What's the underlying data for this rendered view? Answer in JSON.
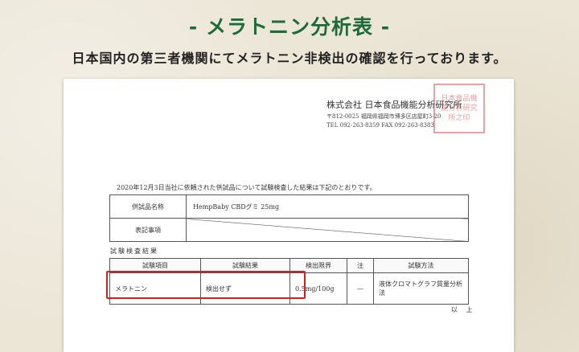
{
  "title": "- メラトニン分析表 -",
  "subtitle": "日本国内の第三者機関にてメラトニン非検出の確認を行っております。",
  "document": {
    "lab_name": "株式会社 日本食品機能分析研究所",
    "lab_postal_address": "〒812-0025 福岡県福岡市博多区店屋町3-20",
    "lab_phone_fax": "TEL 092-263-8359 FAX 092-263-8383",
    "seal_text": "日本食品機能分析研究所之印",
    "intro": "2020年12月3日当社に依頼された供試品について試験検査した結果は下記のとおりです。",
    "info_table": {
      "sample_label": "供試品名称",
      "sample_value": "HempBaby CBDグミ 25mg",
      "notation_label": "表記事項",
      "notation_value": ""
    },
    "results_title": "試験検査結果",
    "results_table": {
      "headers": [
        "試験項目",
        "試験結果",
        "検出限界",
        "注",
        "試験方法"
      ],
      "rows": [
        [
          "メラトニン",
          "検出せず",
          "0.5mg/100g",
          "—",
          "液体クロマトグラフ質量分析法"
        ]
      ]
    },
    "closing": "以 上"
  }
}
